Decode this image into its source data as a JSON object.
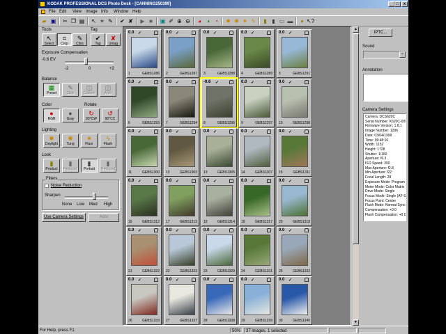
{
  "window": {
    "title": "KODAK PROFESSIONAL DCS Photo Desk - [CANNING250399]",
    "min_label": "_",
    "max_label": "□",
    "close_label": "x"
  },
  "menu": [
    "File",
    "Edit",
    "View",
    "Image",
    "Info",
    "Window",
    "Help"
  ],
  "tools": {
    "header": "Tools",
    "items": [
      "Select",
      "Crop",
      "Click"
    ],
    "tag_header": "Tag",
    "tag_items": [
      "Tag",
      "Untag"
    ]
  },
  "exposure": {
    "header": "Exposure Compensation",
    "value": "-0.6 EV",
    "scale": [
      "-2",
      "0",
      "+2"
    ]
  },
  "balance": {
    "header": "Balance",
    "items": [
      "Preset",
      "Click",
      "Custom",
      "Auto"
    ]
  },
  "color": {
    "header": "Color",
    "items": [
      "RGB",
      "Gray"
    ]
  },
  "rotate": {
    "header": "Rotate",
    "items": [
      "90°CW",
      "90°CC"
    ]
  },
  "lighting": {
    "header": "Lighting",
    "items": [
      "Daylight",
      "Tung",
      "Fluor",
      "Flash"
    ]
  },
  "look": {
    "header": "Look",
    "items": [
      "Product",
      "Reduced",
      "Portrait",
      "Reduced"
    ]
  },
  "filters": {
    "header": "Filters",
    "noise_reduction": "Noise Reduction",
    "sharpen_label": "Sharpen",
    "sharpen_levels": [
      "None",
      "Low",
      "Med",
      "High"
    ]
  },
  "use_camera_settings": "Use Camera Settings",
  "auto_button": "Auto",
  "thumbnails": [
    {
      "index": "0.0",
      "num": "1",
      "code": "GEBS1286",
      "c1": "#c8d8e8",
      "c2": "#2a4a88"
    },
    {
      "index": "0.0",
      "num": "2",
      "code": "GEBS1287",
      "c1": "#7aa0c8",
      "c2": "#5a6838"
    },
    {
      "index": "0.0",
      "num": "3",
      "code": "GEBS1288",
      "c1": "#486838",
      "c2": "#a8b888"
    },
    {
      "index": "0.0",
      "num": "4",
      "code": "GEBS1289",
      "c1": "#6a8848",
      "c2": "#3a4a28"
    },
    {
      "index": "0.0",
      "num": "5",
      "code": "GEBS1291",
      "c1": "#98b8d8",
      "c2": "#6a8040"
    },
    {
      "index": "0.0",
      "num": "6",
      "code": "GEBS1293",
      "c1": "#304828",
      "c2": "#90a880"
    },
    {
      "index": "0.0",
      "num": "7",
      "code": "GEBS1294",
      "c1": "#8a8878",
      "c2": "#181810"
    },
    {
      "index": "-0.6",
      "num": "8",
      "code": "GEBS1296",
      "c1": "#707468",
      "c2": "#3a4030"
    },
    {
      "index": "0.0",
      "num": "9",
      "code": "GEBS1297",
      "c1": "#c8d0c0",
      "c2": "#4a5a38"
    },
    {
      "index": "0.0",
      "num": "10",
      "code": "GEBS1298",
      "c1": "#b8c0b0",
      "c2": "#787870"
    },
    {
      "index": "0.0",
      "num": "11",
      "code": "GEBS1300",
      "c1": "#486838",
      "c2": "#c8d8b0"
    },
    {
      "index": "0.0",
      "num": "12",
      "code": "GEBS1302",
      "c1": "#605840",
      "c2": "#a89878"
    },
    {
      "index": "0.0",
      "num": "13",
      "code": "GEBS1305",
      "c1": "#a8b098",
      "c2": "#3a4a30"
    },
    {
      "index": "0.0",
      "num": "14",
      "code": "GEBS1307",
      "c1": "#b0b8c0",
      "c2": "#506040"
    },
    {
      "index": "0.0",
      "num": "15",
      "code": "GEBS1311",
      "c1": "#587838",
      "c2": "#a07858"
    },
    {
      "index": "0.0",
      "num": "16",
      "code": "GEBS1312",
      "c1": "#587848",
      "c2": "#2a3020"
    },
    {
      "index": "0.0",
      "num": "17",
      "code": "GEBS1313",
      "c1": "#80a060",
      "c2": "#403828"
    },
    {
      "index": "0.0",
      "num": "18",
      "code": "GEBS1314",
      "c1": "#a8b0a0",
      "c2": "#404038"
    },
    {
      "index": "0.0",
      "num": "19",
      "code": "GEBS1317",
      "c1": "#386828",
      "c2": "#a8c088"
    },
    {
      "index": "0.0",
      "num": "20",
      "code": "GEBS1318",
      "c1": "#98b8d0",
      "c2": "#4a7030"
    },
    {
      "index": "0.0",
      "num": "21",
      "code": "GEBS1322",
      "c1": "#a89070",
      "c2": "#c05038"
    },
    {
      "index": "0.0",
      "num": "22",
      "code": "GEBS1323",
      "c1": "#b8c8d8",
      "c2": "#384028"
    },
    {
      "index": "0.0",
      "num": "23",
      "code": "GEBS1329",
      "c1": "#c8d8e8",
      "c2": "#4a6838"
    },
    {
      "index": "0.0",
      "num": "24",
      "code": "GEBS1331",
      "c1": "#587838",
      "c2": "#98a878"
    },
    {
      "index": "0.0",
      "num": "25",
      "code": "GEBS1332",
      "c1": "#98a8b8",
      "c2": "#806848"
    },
    {
      "index": "0.0",
      "num": "26",
      "code": "GEBS1333",
      "c1": "#c8c8c0",
      "c2": "#802820"
    },
    {
      "index": "0.0",
      "num": "27",
      "code": "GEBS1337",
      "c1": "#e8e8e0",
      "c2": "#384048"
    },
    {
      "index": "0.0",
      "num": "28",
      "code": "GEBS1338",
      "c1": "#3868b8",
      "c2": "#e8e8e8"
    },
    {
      "index": "0.0",
      "num": "29",
      "code": "GEBS1339",
      "c1": "#88b0d8",
      "c2": "#e8e8e0"
    },
    {
      "index": "0.0",
      "num": "30",
      "code": "GEBS1340",
      "c1": "#2858a8",
      "c2": "#f0f0f0"
    }
  ],
  "right": {
    "iptc_button": "IPTC...",
    "sound_header": "Sound",
    "annotation_header": "Annotation",
    "camera_header": "Camera Settings",
    "camera_settings": [
      "Camera:  DCS620C",
      "Serial Number:  K620C-00541",
      "Firmware Version:  1.8.1",
      "Image Number:  1296",
      "Date:  03/04/1999",
      "Time:  09:48:16",
      "Width:  1152",
      "Height:  1728",
      "Shutter:  1/160",
      "Aperture:  f6.3",
      "ISO Speed:  200",
      "Max Aperture:  f2.8",
      "Min Aperture:  f22",
      "Focal Length:  28",
      "Exposure Mode:  Program AE (P)",
      "Meter Mode:  Color Matrix",
      "Drive Mode:  Single",
      "Focus Mode:  Single (AF-S)",
      "Focus Point:  Center",
      "Flash Mode:  Normal Sync",
      "Compensation:  +0.0",
      "Flash Compensation:  +0.0"
    ]
  },
  "status": {
    "help": "For Help, press F1",
    "zoom": "50%",
    "count": "37 images, 1 selected"
  }
}
